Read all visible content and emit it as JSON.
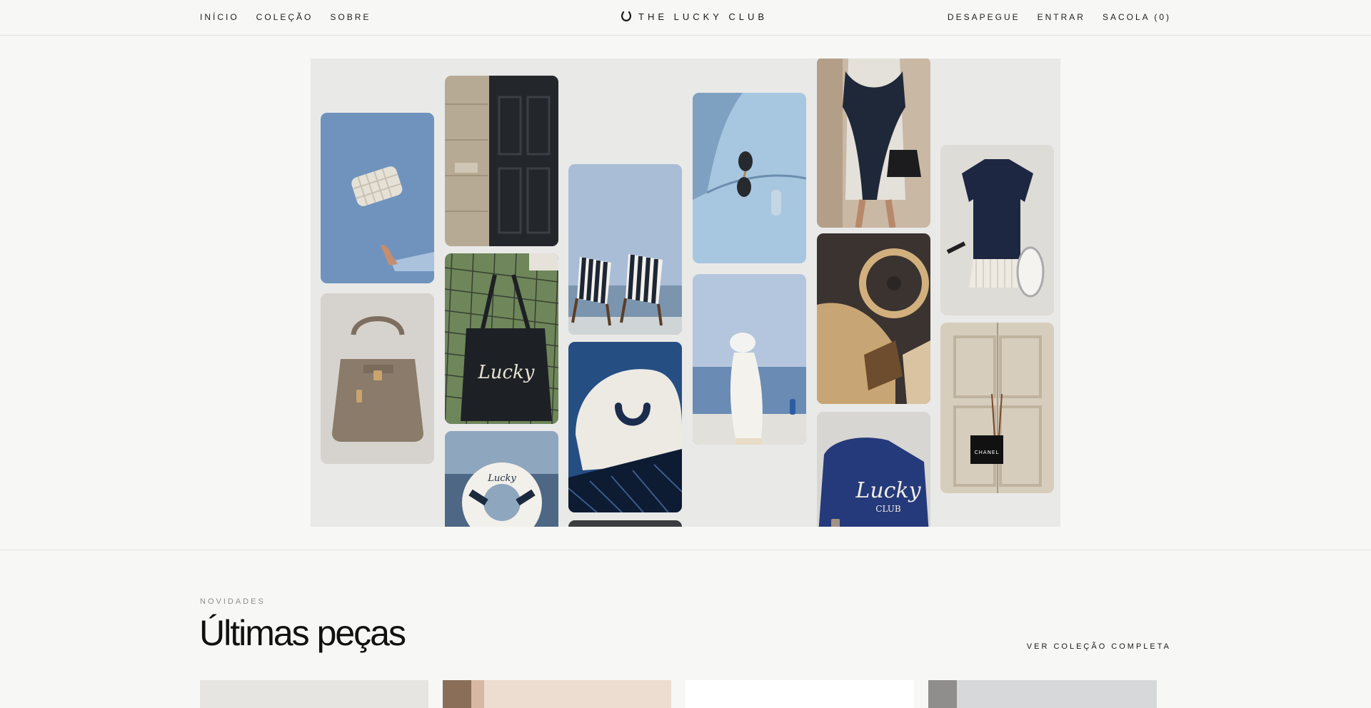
{
  "header": {
    "nav_left": [
      "INÍCIO",
      "COLEÇÃO",
      "SOBRE"
    ],
    "brand": "THE LUCKY CLUB",
    "brand_icon": "horseshoe-icon",
    "nav_right": [
      "DESAPEGUE",
      "ENTRAR",
      "SACOLA (0)"
    ]
  },
  "hero": {
    "tiles": [
      {
        "name": "tile-quilted-bag-toss",
        "image": "quilted-bag-sky"
      },
      {
        "name": "tile-taupe-handbag",
        "image": "taupe-handbag"
      },
      {
        "name": "tile-stone-doorway",
        "image": "stone-doorway"
      },
      {
        "name": "tile-tennis-tote",
        "image": "tennis-net-tote",
        "print": "The Lucky CLUB"
      },
      {
        "name": "tile-life-ring",
        "image": "life-ring-sea",
        "print": "The Lucky CLUB"
      },
      {
        "name": "tile-beach-chairs",
        "image": "striped-beach-chairs"
      },
      {
        "name": "tile-horseshoe-cap",
        "image": "horseshoe-cap"
      },
      {
        "name": "tile-blue-car-sunglasses",
        "image": "blue-car-sunglasses"
      },
      {
        "name": "tile-seaside-woman",
        "image": "seaside-woman"
      },
      {
        "name": "tile-knit-sweater-dress",
        "image": "knit-sweater-dress"
      },
      {
        "name": "tile-car-interior",
        "image": "car-interior-bag"
      },
      {
        "name": "tile-navy-tote",
        "image": "navy-tote",
        "print": "The Lucky CLUB"
      },
      {
        "name": "tile-polo-dress",
        "image": "navy-polo-dress"
      },
      {
        "name": "tile-chanel-door",
        "image": "door-chanel-bag",
        "print": "CHANEL"
      }
    ]
  },
  "section": {
    "eyebrow": "NOVIDADES",
    "title": "Últimas peças",
    "see_all": "VER COLEÇÃO COMPLETA"
  },
  "colors": {
    "background": "#f7f7f5",
    "hero_bg": "#e9e9e8",
    "text": "#1a1a1a",
    "muted": "#8c8c88"
  }
}
